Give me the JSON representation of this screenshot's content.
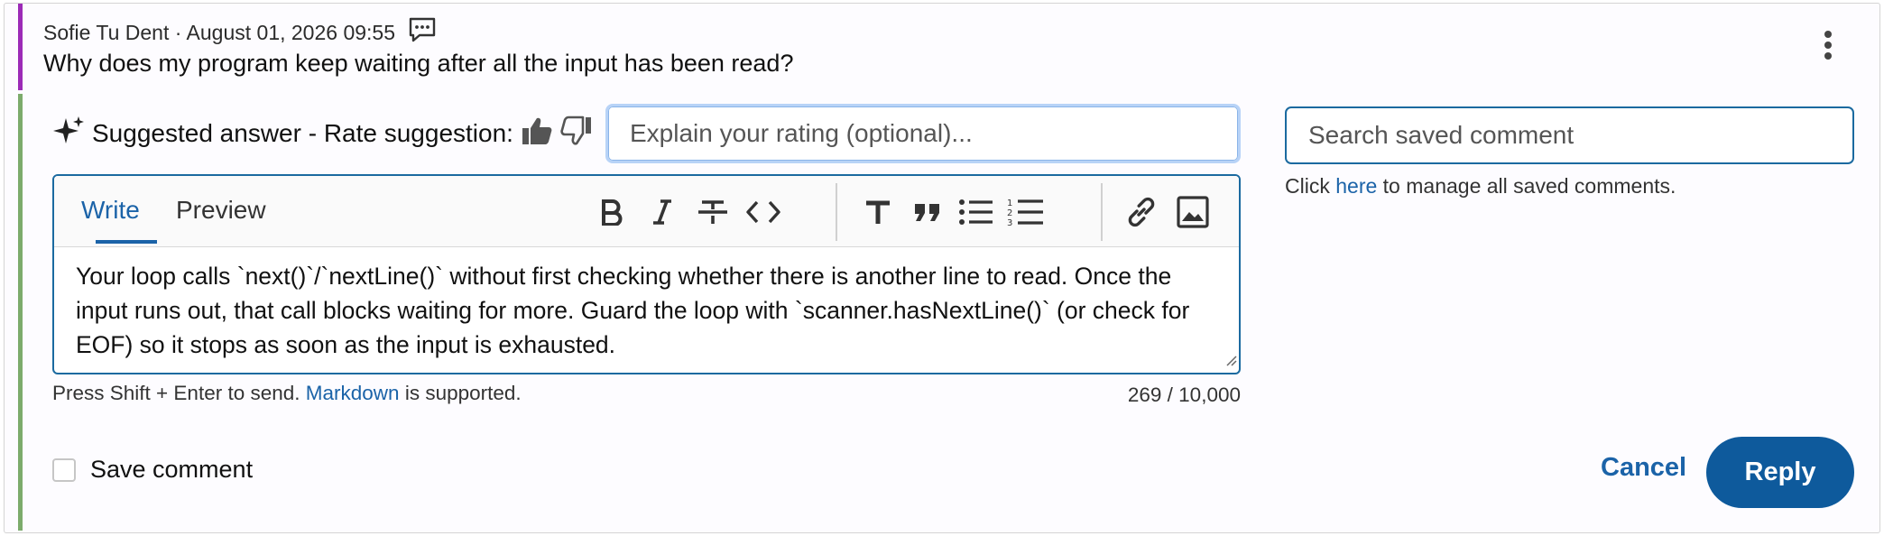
{
  "comment": {
    "author_line": "Sofie Tu Dent · August 01, 2026 09:55",
    "question": "Why does my program keep waiting after all the input has been read?"
  },
  "suggestion": {
    "label": "Suggested answer - Rate suggestion:",
    "rating_placeholder": "Explain your rating (optional)..."
  },
  "editor": {
    "tabs": {
      "write": "Write",
      "preview": "Preview"
    },
    "body": "Your loop calls `next()`/`nextLine()` without first checking whether there is another line to read. Once the input runs out, that call blocks waiting for more. Guard the loop with `scanner.hasNextLine()` (or check for EOF) so it stops as soon as the input is exhausted.",
    "toolbar_icons": [
      "bold-icon",
      "italic-icon",
      "strikethrough-icon",
      "code-icon",
      "heading-icon",
      "quote-icon",
      "bulleted-list-icon",
      "numbered-list-icon",
      "link-icon",
      "image-icon"
    ]
  },
  "hint": {
    "prefix": "Press Shift + Enter to send.",
    "link": "Markdown",
    "suffix": "is supported."
  },
  "counter": "269 / 10,000",
  "save_comment_label": "Save comment",
  "actions": {
    "cancel": "Cancel",
    "reply": "Reply"
  },
  "saved_comments": {
    "search_placeholder": "Search saved comment",
    "manage_prefix": "Click",
    "manage_link": "here",
    "manage_suffix": "to manage all saved comments."
  },
  "colors": {
    "question_accent": "#9c2bb7",
    "answer_accent": "#7cab6c",
    "primary": "#0e5a9c",
    "link": "#1b63a8"
  }
}
